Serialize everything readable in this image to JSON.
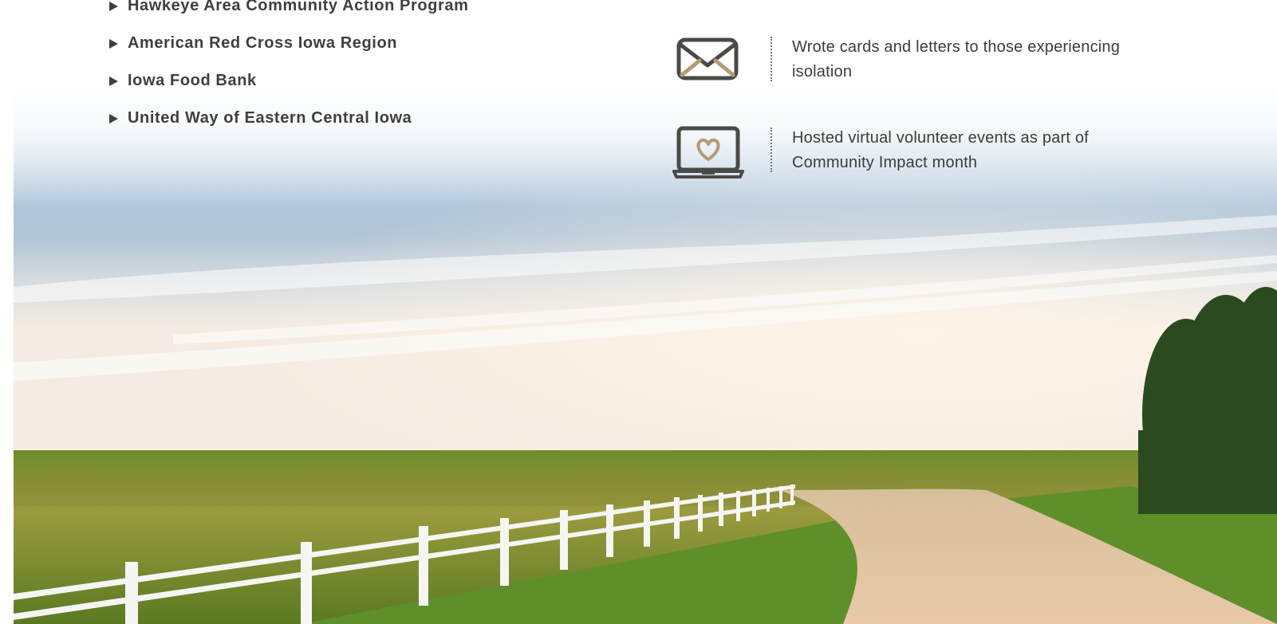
{
  "partners": {
    "items": [
      "Hawkeye Area Community Action Program",
      "American Red Cross Iowa Region",
      "Iowa Food Bank",
      "United Way of Eastern Central Iowa"
    ]
  },
  "activities": [
    {
      "icon": "envelope-icon",
      "text": "Wrote cards and letters to those experiencing isolation"
    },
    {
      "icon": "laptop-heart-icon",
      "text": "Hosted virtual volunteer events as part of Community Impact month"
    }
  ],
  "colors": {
    "text": "#3f3f3f",
    "icon_outline": "#4a4a46",
    "icon_accent": "#b39b74"
  }
}
